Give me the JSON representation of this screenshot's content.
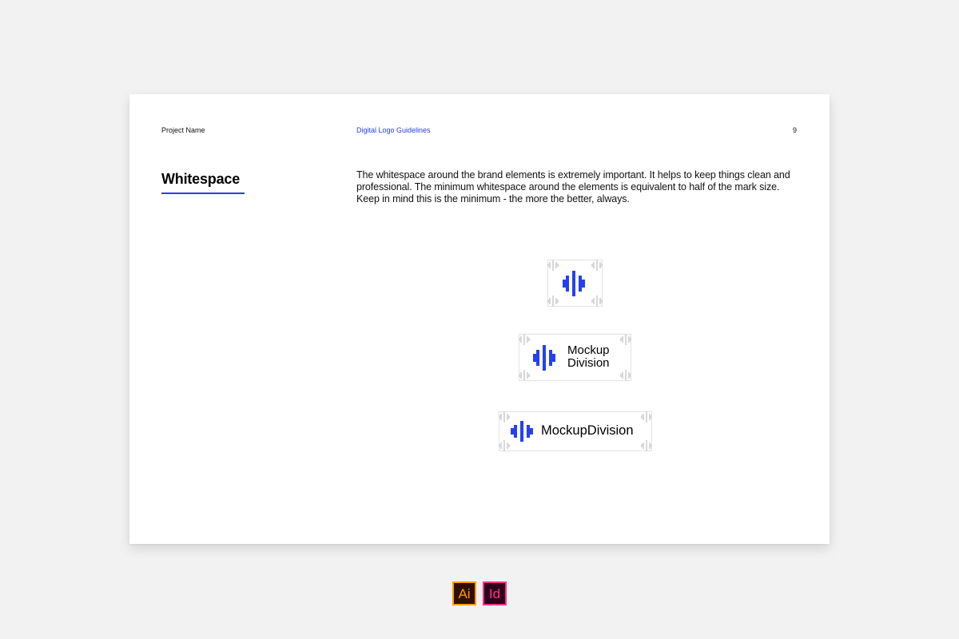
{
  "header": {
    "project_name": "Project Name",
    "document_title": "Digital Logo Guidelines",
    "page_number": "9"
  },
  "section": {
    "title": "Whitespace",
    "body": "The whitespace around the brand elements is extremely important. It helps to keep things clean and professional. The minimum whitespace around the elements is equivalent to half of the mark size. Keep in mind this is the minimum - the more the better, always."
  },
  "logos": {
    "stacked_line1": "Mockup",
    "stacked_line2": "Division",
    "horizontal": "MockupDivision"
  },
  "software_badges": {
    "illustrator": "Ai",
    "indesign": "Id"
  },
  "colors": {
    "accent": "#2540f2",
    "background": "#f2f2f2",
    "illustrator": "#ff9a00",
    "indesign": "#ff3389"
  },
  "icons": [
    "brand-mark-icon",
    "spacing-marker-icon",
    "illustrator-icon",
    "indesign-icon"
  ]
}
